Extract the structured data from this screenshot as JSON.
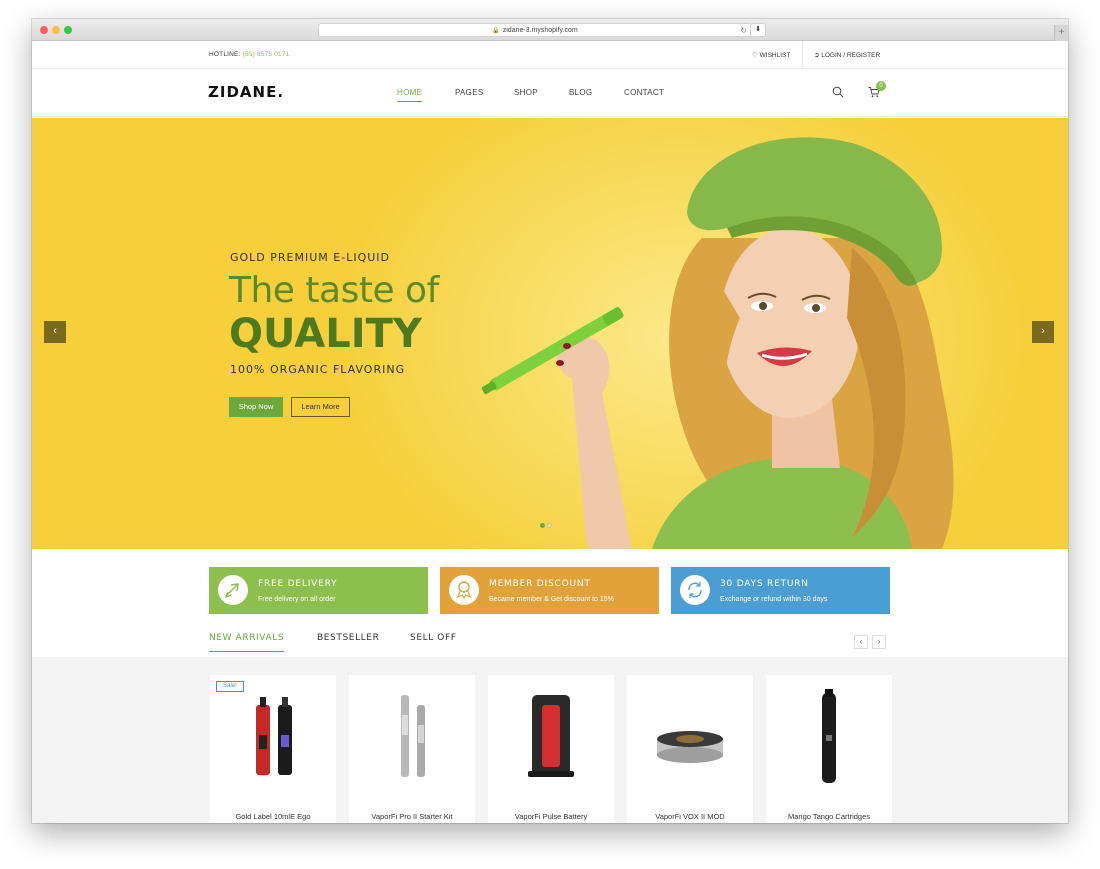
{
  "browser": {
    "url": "zidane-3.myshopify.com"
  },
  "topbar": {
    "hotline_label": "HOTLINE:",
    "hotline_number": "(65) 8575 0171",
    "wishlist": "WISHLIST",
    "login": "LOGIN / REGISTER"
  },
  "header": {
    "logo": "ZIDANE.",
    "nav": [
      "HOME",
      "PAGES",
      "SHOP",
      "BLOG",
      "CONTACT"
    ],
    "cart_count": "0"
  },
  "hero": {
    "subtitle": "GOLD PREMIUM E-LIQUID",
    "title_line1": "The taste of",
    "title_line2": "QUALITY",
    "tagline": "100% ORGANIC FLAVORING",
    "primary_button": "Shop Now",
    "secondary_button": "Learn More"
  },
  "features": [
    {
      "title": "FREE DELIVERY",
      "desc": "Free delivery on all order",
      "color": "#8cbf4d",
      "icon": "airplane-icon"
    },
    {
      "title": "MEMBER DISCOUNT",
      "desc": "Became member & Get discount to 15%",
      "color": "#e2a23a",
      "icon": "badge-icon"
    },
    {
      "title": "30 DAYS RETURN",
      "desc": "Exchange or refund within 30 days",
      "color": "#4b9ed2",
      "icon": "refresh-icon"
    }
  ],
  "tabs": [
    "NEW ARRIVALS",
    "BESTSELLER",
    "SELL OFF"
  ],
  "products": [
    {
      "name": "Gold Label 10mlE Ego",
      "badge": "Sale!"
    },
    {
      "name": "VaporFi Pro II Starter Kit"
    },
    {
      "name": "VaporFi Pulse Battery"
    },
    {
      "name": "VaporFi VOX II MOD"
    },
    {
      "name": "Mango Tango Cartridges"
    }
  ],
  "colors": {
    "accent": "#6ea83a",
    "hero_bg": "#f6cf3a"
  }
}
